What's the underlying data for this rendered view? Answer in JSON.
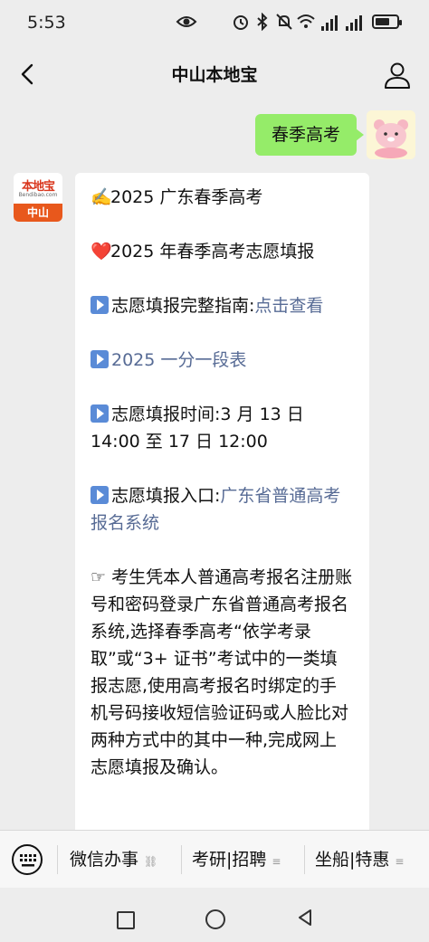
{
  "status_bar": {
    "time": "5:53",
    "battery_level": 0.7
  },
  "header": {
    "title": "中山本地宝"
  },
  "user_message": {
    "text": "春季高考"
  },
  "bot": {
    "avatar": {
      "logo_text": "本地宝",
      "logo_sub": "Bendibao.com",
      "city": "中山"
    },
    "line1_emoji": "✍️",
    "line1": "2025 广东春季高考",
    "line2_emoji": "❤️",
    "line2": "2025 年春季高考志愿填报",
    "item1_label": "志愿填报完整指南:",
    "item1_link": "点击查看",
    "item2_link": "2025 一分一段表",
    "item3_label": "志愿填报时间:3 月 13 日 14:00 至 17 日 12:00",
    "item4_label": "志愿填报入口:",
    "item4_link": "广东省普通高考报名系统",
    "paragraph_icon": "☞",
    "paragraph": "考生凭本人普通高考报名注册账号和密码登录广东省普通高考报名系统,选择春季高考“依学考录取”或“3+ 证书”考试中的一类填报志愿,使用高考报名时绑定的手机号码接收短信验证码或人脸比对两种方式中的其中一种,完成网上志愿填报及确认。"
  },
  "menu": {
    "item1": "微信办事",
    "item2": "考研|招聘",
    "item3": "坐船|特惠",
    "item1_icon": "link-icon",
    "item2_icon": "menu-lines-icon",
    "item3_icon": "menu-lines-icon"
  },
  "colors": {
    "accent_link": "#576b95",
    "user_bubble": "#95ec69",
    "logo_orange": "#e8581c"
  }
}
